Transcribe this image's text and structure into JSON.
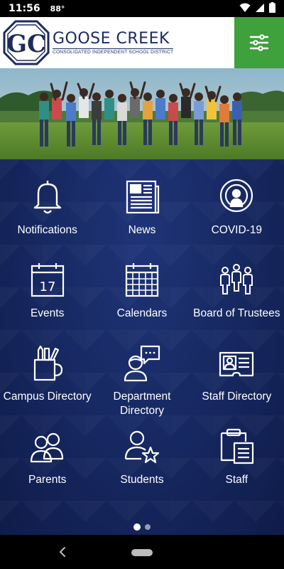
{
  "status_bar": {
    "time": "11:56",
    "temperature": "88°",
    "icons": [
      "wifi-icon",
      "signal-icon",
      "battery-icon"
    ]
  },
  "header": {
    "logo_title": "GOOSE CREEK",
    "logo_subtitle": "Consolidated Independent School District",
    "logo_letters": "GC",
    "menu_icon": "sliders-icon"
  },
  "tiles": [
    {
      "label": "Notifications",
      "icon": "bell-icon"
    },
    {
      "label": "News",
      "icon": "newspaper-icon"
    },
    {
      "label": "COVID-19",
      "icon": "broadcast-icon"
    },
    {
      "label": "Events",
      "icon": "calendar-day-icon",
      "day": "17"
    },
    {
      "label": "Calendars",
      "icon": "calendar-grid-icon"
    },
    {
      "label": "Board of Trustees",
      "icon": "people-group-icon"
    },
    {
      "label": "Campus Directory",
      "icon": "pencil-cup-icon"
    },
    {
      "label": "Department Directory",
      "icon": "chat-person-icon"
    },
    {
      "label": "Staff Directory",
      "icon": "id-card-icon"
    },
    {
      "label": "Parents",
      "icon": "two-people-icon"
    },
    {
      "label": "Students",
      "icon": "person-star-icon"
    },
    {
      "label": "Staff",
      "icon": "clipboard-icon"
    }
  ],
  "pager": {
    "count": 2,
    "active": 1
  },
  "colors": {
    "brand_navy": "#1c2a5e",
    "menu_green": "#3ea13c",
    "main_bg": "#16275f"
  }
}
